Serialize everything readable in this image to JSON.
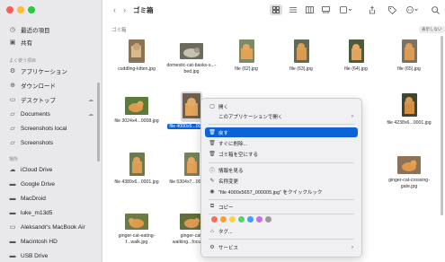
{
  "window": {
    "title": "ゴミ箱"
  },
  "toolbar": {
    "back": "‹",
    "forward": "›",
    "search_icon": "search-icon"
  },
  "sidebar": {
    "sections": [
      {
        "key": "recent",
        "label": "最近の項目"
      },
      {
        "key": "shared",
        "label": "共有"
      }
    ],
    "favorites_heading": "よく使う項目",
    "favorites": [
      {
        "label": "アプリケーション",
        "icon": "app-icon"
      },
      {
        "label": "ダウンロード",
        "icon": "download-icon"
      },
      {
        "label": "デスクトップ",
        "icon": "desktop-icon"
      },
      {
        "label": "Documents",
        "icon": "folder-icon"
      },
      {
        "label": "Screenshots local",
        "icon": "folder-icon"
      },
      {
        "label": "Screenshots",
        "icon": "folder-icon"
      }
    ],
    "locations_heading": "場所",
    "locations": [
      {
        "label": "iCloud Drive",
        "icon": "cloud-icon"
      },
      {
        "label": "Google Drive",
        "icon": "drive-icon"
      },
      {
        "label": "MacDroid",
        "icon": "drive-icon"
      },
      {
        "label": "luke_m13d5",
        "icon": "drive-icon"
      },
      {
        "label": "Aleksandr's MacBook Air",
        "icon": "laptop-icon"
      },
      {
        "label": "Macintosh HD",
        "icon": "disk-icon"
      },
      {
        "label": "USB Drive",
        "icon": "disk-icon"
      }
    ]
  },
  "content": {
    "path_label": "ゴミ箱",
    "show_all": "表示しない",
    "files": [
      {
        "name": "cuddling-kitten.jpg"
      },
      {
        "name": "domestic-cat-basks-s...-bed.jpg"
      },
      {
        "name": "file (62).jpg"
      },
      {
        "name": "file (63).jpg"
      },
      {
        "name": "file (64).jpg"
      },
      {
        "name": "file (65).jpg"
      },
      {
        "name": "file 3024x4...0008.jpg"
      },
      {
        "name": "file 4000x5...0005.jpg"
      },
      {
        "name": "file 4238x6...0001.jpg"
      },
      {
        "name": "file 4389x6...0001.jpg"
      },
      {
        "name": "file 5304x7...0002.jpg"
      },
      {
        "name": "ginger-cat-crossing-gate.jpg"
      },
      {
        "name": "ginger-cat-eating-f...walk.jpg"
      },
      {
        "name": "ginger-cat-walking...focus.jpg"
      }
    ]
  },
  "context_menu": {
    "items": [
      {
        "label": "開く"
      },
      {
        "label": "このアプリケーションで開く"
      },
      {
        "label": "戻す"
      },
      {
        "label": "すぐに削除..."
      },
      {
        "label": "ゴミ箱を空にする"
      },
      {
        "label": "情報を見る"
      },
      {
        "label": "名称変更"
      },
      {
        "label": "\"file 4000x5657_000005.jpg\" をクイックルック"
      },
      {
        "label": "コピー"
      },
      {
        "label": "タグ..."
      },
      {
        "label": "サービス"
      }
    ],
    "tag_colors": [
      "#ff6b5a",
      "#ff9f2e",
      "#ffd23f",
      "#4cd964",
      "#3aa3ff",
      "#c86cf0",
      "#9a9a9e"
    ]
  }
}
